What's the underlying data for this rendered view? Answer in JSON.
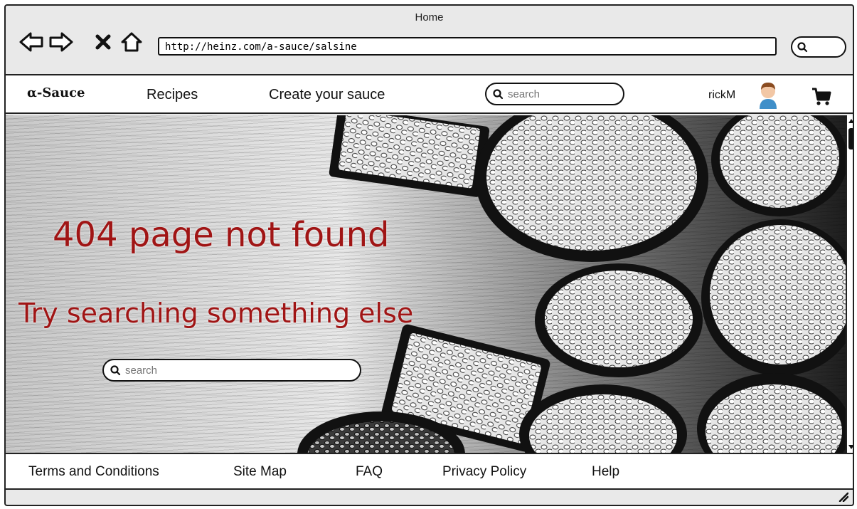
{
  "window": {
    "title": "Home"
  },
  "browser": {
    "url": "http://heinz.com/a-sauce/salsine",
    "icons": [
      "back-arrow-icon",
      "forward-arrow-icon",
      "stop-icon",
      "home-icon",
      "search-icon"
    ]
  },
  "navbar": {
    "logo": "α-Sauce",
    "links": [
      "Recipes",
      "Create your sauce"
    ],
    "search_placeholder": "search",
    "username": "rickM",
    "icons": [
      "avatar-icon",
      "cart-icon"
    ]
  },
  "hero": {
    "headline": "404 page not found",
    "subline": "Try searching something else",
    "search_placeholder": "search",
    "accent_color": "#a01515"
  },
  "footer": {
    "links": [
      "Terms and Conditions",
      "Site Map",
      "FAQ",
      "Privacy Policy",
      "Help"
    ]
  }
}
